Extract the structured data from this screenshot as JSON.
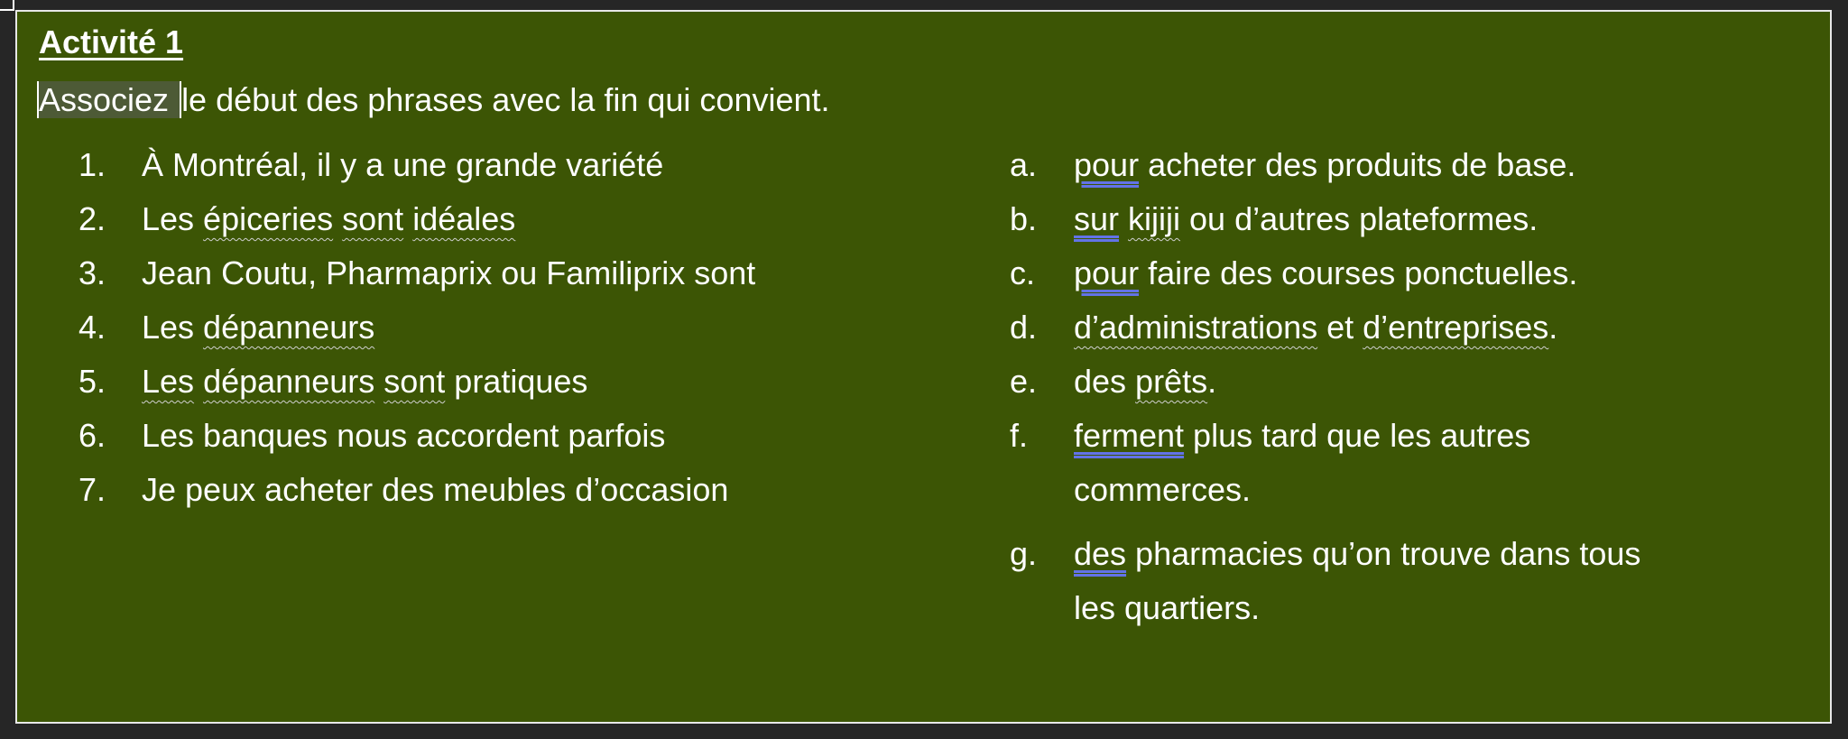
{
  "title": "Activité 1",
  "instruction": {
    "selected": "Associez ",
    "rest": "le début des phrases avec la fin qui convient."
  },
  "left_items": [
    {
      "marker": "1.",
      "segs": [
        {
          "t": "À Montréal, il y a une grande variété"
        }
      ]
    },
    {
      "marker": "2.",
      "segs": [
        {
          "t": "Les "
        },
        {
          "t": "épiceries",
          "u": "wavy"
        },
        {
          "t": " "
        },
        {
          "t": "sont",
          "u": "wavy"
        },
        {
          "t": " "
        },
        {
          "t": "idéales",
          "u": "wavy"
        }
      ]
    },
    {
      "marker": "3.",
      "segs": [
        {
          "t": "Jean Coutu, Pharmaprix ou Familiprix sont"
        }
      ]
    },
    {
      "marker": "4.",
      "segs": [
        {
          "t": "Les "
        },
        {
          "t": "dépanneurs",
          "u": "wavy"
        }
      ]
    },
    {
      "marker": "5.",
      "segs": [
        {
          "t": "Les",
          "u": "wavy"
        },
        {
          "t": " "
        },
        {
          "t": "dépanneurs",
          "u": "wavy"
        },
        {
          "t": " "
        },
        {
          "t": "sont",
          "u": "wavy"
        },
        {
          "t": " pratiques"
        }
      ]
    },
    {
      "marker": "6.",
      "segs": [
        {
          "t": "Les banques nous accordent parfois"
        }
      ]
    },
    {
      "marker": "7.",
      "segs": [
        {
          "t": "Je peux acheter des meubles d’occasion"
        }
      ]
    }
  ],
  "right_items": [
    {
      "marker": "a.",
      "lines": [
        [
          {
            "t": "pour",
            "u": "dbl"
          },
          {
            "t": " acheter des produits de base."
          }
        ]
      ]
    },
    {
      "marker": "b.",
      "lines": [
        [
          {
            "t": "sur",
            "u": "dbl"
          },
          {
            "t": " "
          },
          {
            "t": "kijiji",
            "u": "wavy"
          },
          {
            "t": " ou d’autres plateformes."
          }
        ]
      ]
    },
    {
      "marker": "c.",
      "lines": [
        [
          {
            "t": "pour",
            "u": "dbl"
          },
          {
            "t": " faire des courses ponctuelles."
          }
        ]
      ]
    },
    {
      "marker": "d.",
      "lines": [
        [
          {
            "t": "d’administrations",
            "u": "wavy"
          },
          {
            "t": " et "
          },
          {
            "t": "d’entreprises",
            "u": "wavy"
          },
          {
            "t": "."
          }
        ]
      ]
    },
    {
      "marker": "e.",
      "lines": [
        [
          {
            "t": "des "
          },
          {
            "t": "prêts",
            "u": "wavy"
          },
          {
            "t": "."
          }
        ]
      ]
    },
    {
      "marker": "f.",
      "lines": [
        [
          {
            "t": "ferment",
            "u": "dbl"
          },
          {
            "t": " plus tard que les autres"
          }
        ],
        [
          {
            "t": "commerces."
          }
        ]
      ]
    },
    {
      "marker": "g.",
      "lines": [
        [
          {
            "t": "des",
            "u": "dbl"
          },
          {
            "t": " pharmacies qu’on trouve dans tous"
          }
        ],
        [
          {
            "t": "les quartiers."
          }
        ]
      ]
    }
  ],
  "colors": {
    "background": "#3c5505",
    "frame": "#262626",
    "grammar_underline": "#6273e8"
  }
}
